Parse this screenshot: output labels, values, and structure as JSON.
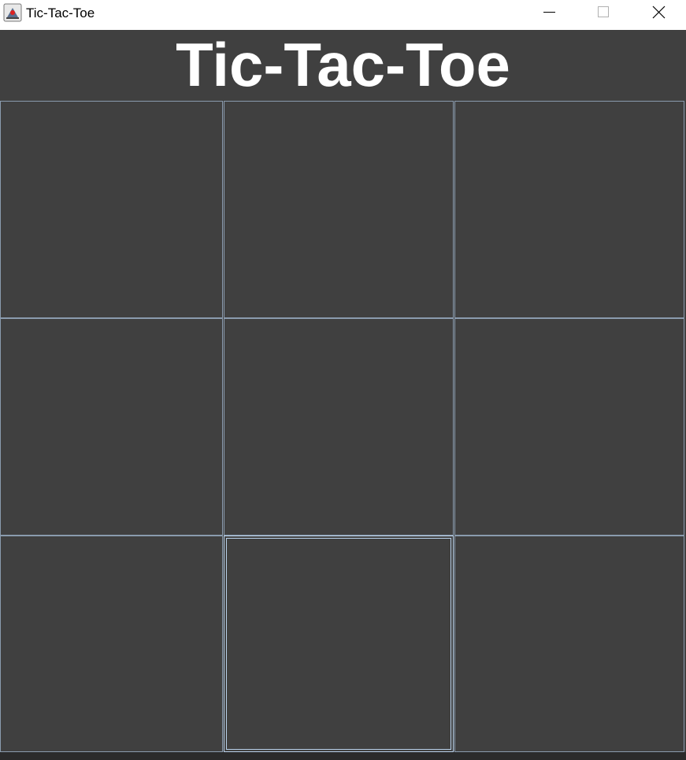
{
  "window": {
    "title": "Tic-Tac-Toe",
    "icon": "java-cup-icon",
    "controls": [
      "minimize-icon",
      "maximize-icon",
      "close-icon"
    ]
  },
  "game": {
    "heading": "Tic-Tac-Toe",
    "cells": [
      {
        "row": 1,
        "col": 1,
        "mark": ""
      },
      {
        "row": 1,
        "col": 2,
        "mark": ""
      },
      {
        "row": 1,
        "col": 3,
        "mark": ""
      },
      {
        "row": 2,
        "col": 1,
        "mark": ""
      },
      {
        "row": 2,
        "col": 2,
        "mark": ""
      },
      {
        "row": 2,
        "col": 3,
        "mark": ""
      },
      {
        "row": 3,
        "col": 1,
        "mark": ""
      },
      {
        "row": 3,
        "col": 2,
        "mark": ""
      },
      {
        "row": 3,
        "col": 3,
        "mark": ""
      }
    ],
    "focused_cell": {
      "row": 3,
      "col": 2
    }
  },
  "colors": {
    "background": "#404040",
    "cell_border": "#8a9bae",
    "focus_border": "#b9d1ea",
    "heading_text": "#ffffff"
  }
}
